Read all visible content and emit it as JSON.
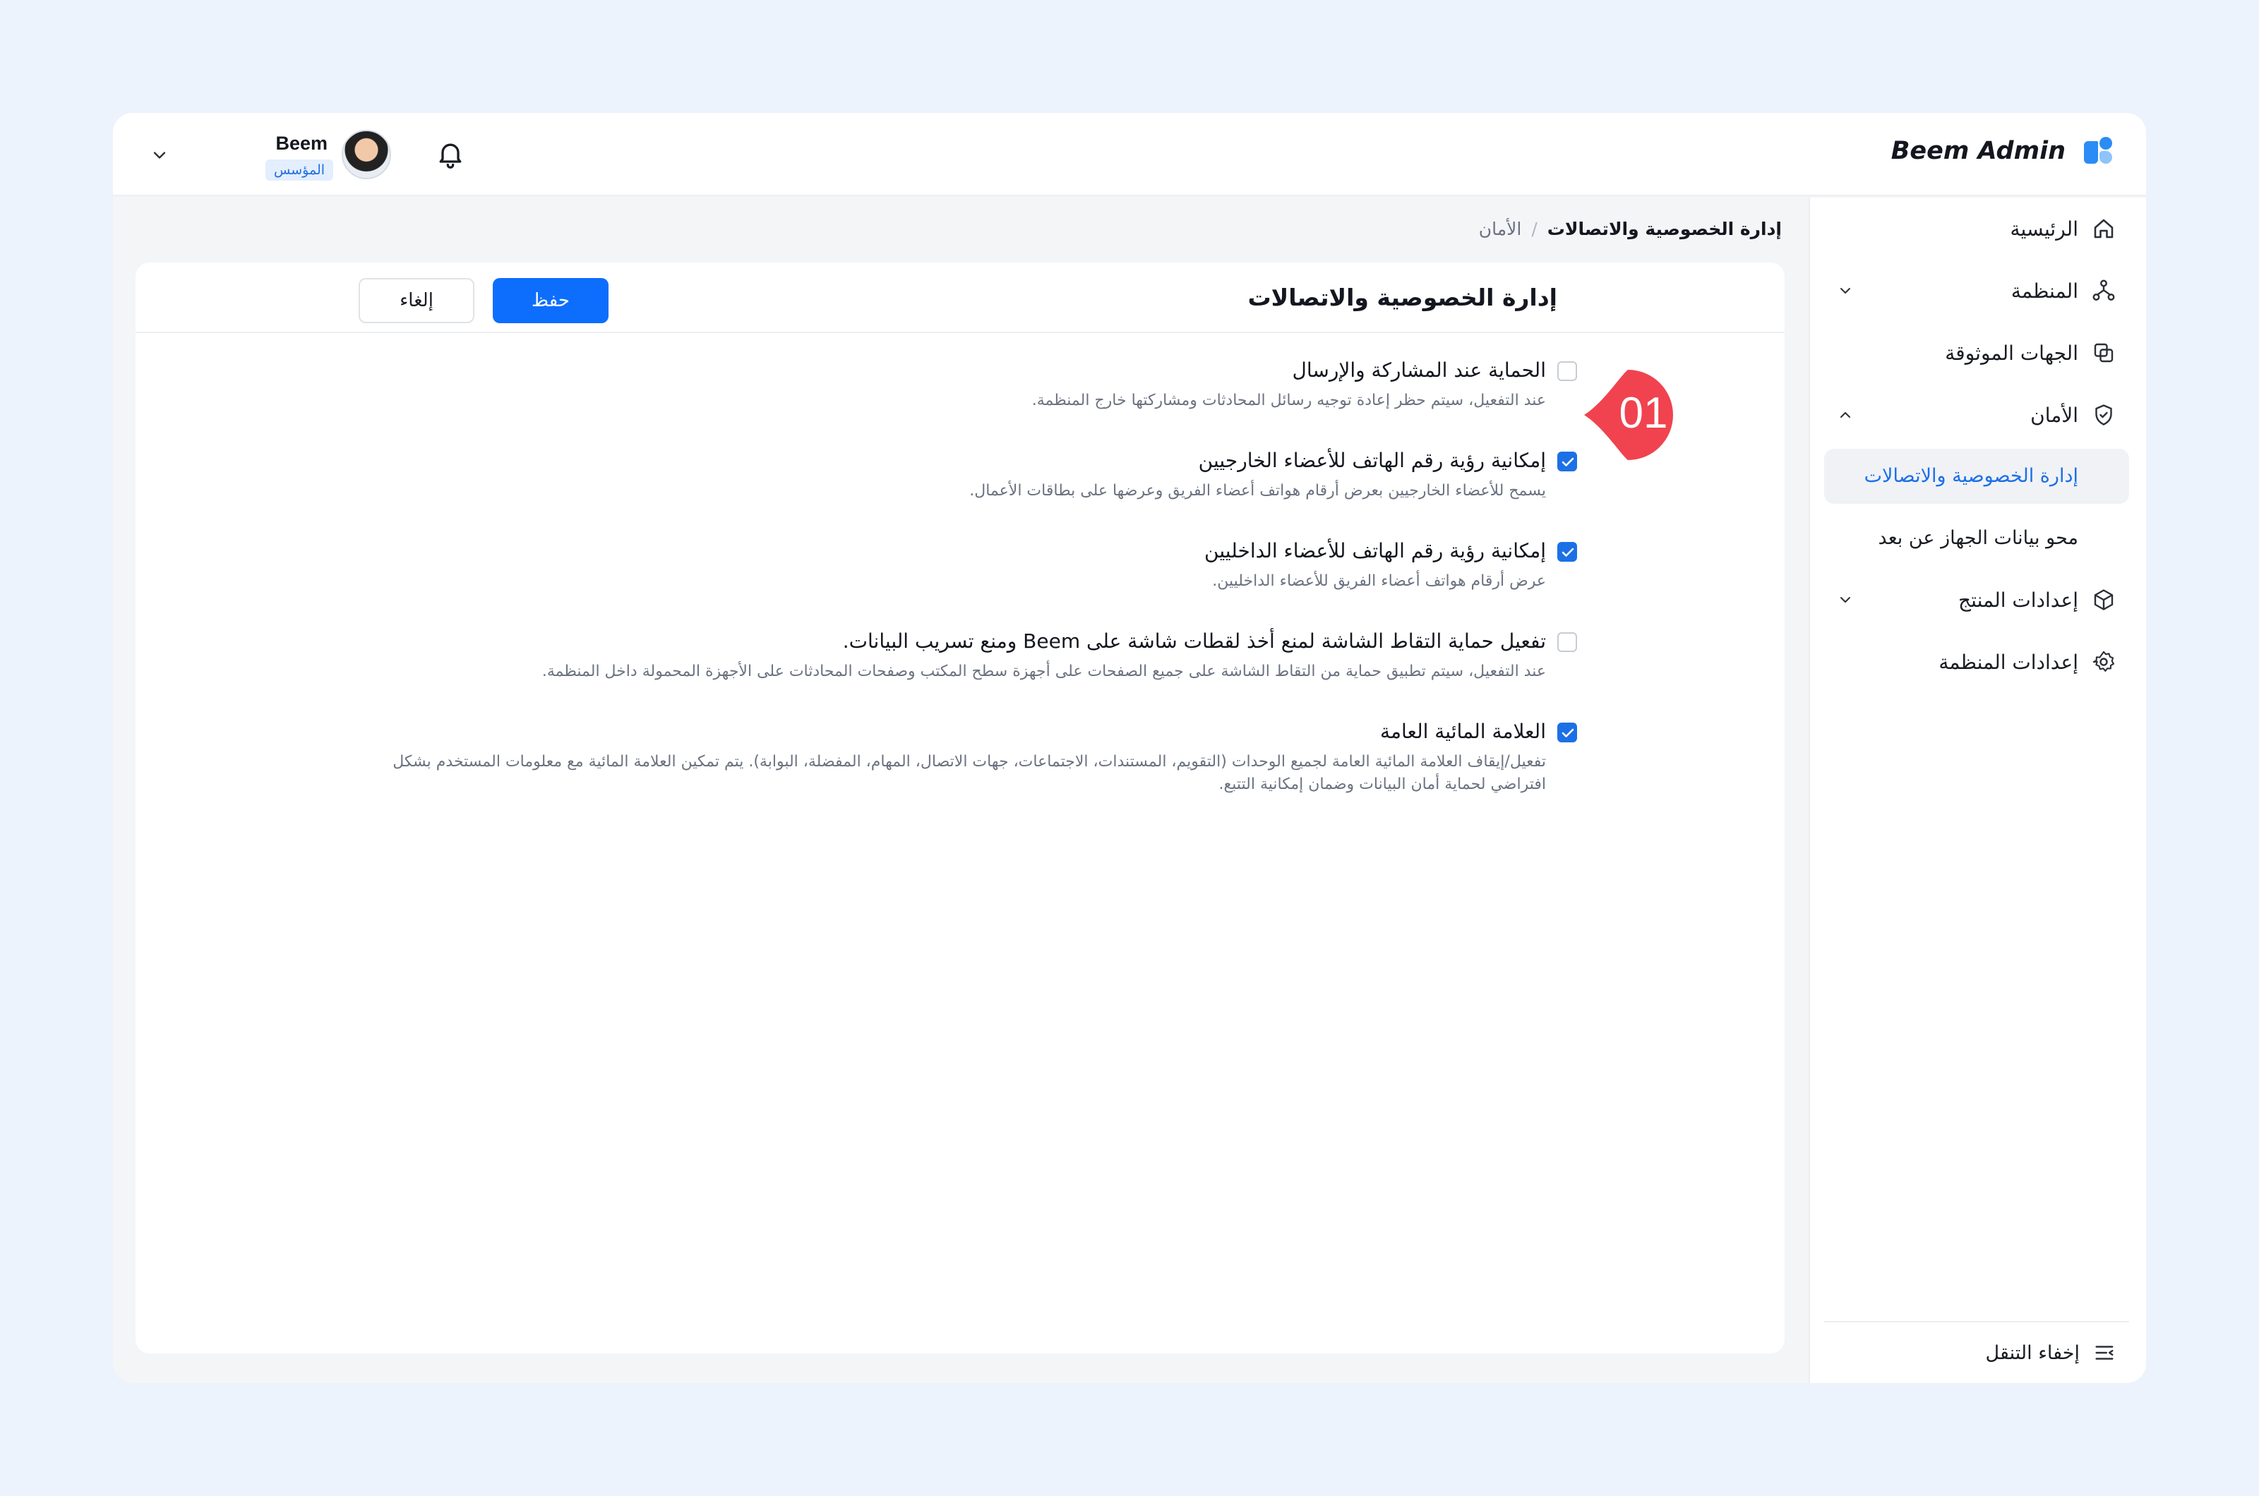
{
  "header": {
    "brand": "Beem Admin",
    "user_name": "Beem",
    "user_role": "المؤسس"
  },
  "breadcrumb": {
    "parent": "الأمان",
    "separator": "/",
    "current": "إدارة الخصوصية والاتصالات"
  },
  "sidebar": {
    "items": [
      {
        "label": "الرئيسية",
        "icon": "home-icon"
      },
      {
        "label": "المنظمة",
        "icon": "org-chart-icon",
        "expandable": true
      },
      {
        "label": "الجهات الموثوقة",
        "icon": "trusted-entities-icon"
      },
      {
        "label": "الأمان",
        "icon": "shield-icon",
        "expanded": true
      },
      {
        "label": "إدارة الخصوصية والاتصالات",
        "active": true
      },
      {
        "label": "محو بيانات الجهاز عن بعد"
      },
      {
        "label": "إعدادات المنتج",
        "icon": "box-icon",
        "expandable": true
      },
      {
        "label": "إعدادات المنظمة",
        "icon": "gear-icon"
      }
    ],
    "footer_label": "إخفاء التنقل"
  },
  "page": {
    "title": "إدارة الخصوصية والاتصالات",
    "save_label": "حفظ",
    "cancel_label": "إلغاء",
    "marker": "01"
  },
  "options": [
    {
      "title": "الحماية عند المشاركة والإرسال",
      "desc": "عند التفعيل، سيتم حظر إعادة توجيه رسائل المحادثات ومشاركتها خارج المنظمة.",
      "checked": false
    },
    {
      "title": "إمكانية رؤية رقم الهاتف للأعضاء الخارجيين",
      "desc": "يسمح للأعضاء الخارجيين بعرض أرقام هواتف أعضاء الفريق وعرضها على بطاقات الأعمال.",
      "checked": true
    },
    {
      "title": "إمكانية رؤية رقم الهاتف للأعضاء الداخليين",
      "desc": "عرض أرقام هواتف أعضاء الفريق للأعضاء الداخليين.",
      "checked": true
    },
    {
      "title": "تفعيل حماية التقاط الشاشة لمنع أخذ لقطات شاشة على Beem ومنع تسريب البيانات.",
      "desc": "عند التفعيل، سيتم تطبيق حماية من التقاط الشاشة على جميع الصفحات على أجهزة سطح المكتب وصفحات المحادثات على الأجهزة المحمولة داخل المنظمة.",
      "checked": false
    },
    {
      "title": "العلامة المائية العامة",
      "desc": "تفعيل/إيقاف العلامة المائية العامة لجميع الوحدات (التقويم، المستندات، الاجتماعات، جهات الاتصال، المهام، المفضلة، البوابة). يتم تمكين العلامة المائية مع معلومات المستخدم بشكل افتراضي لحماية أمان البيانات وضمان إمكانية التتبع.",
      "checked": true
    }
  ],
  "colors": {
    "accent": "#1c70e6",
    "primary_button": "#0d6efd",
    "marker": "#f0434f",
    "background": "#edf3fc"
  }
}
